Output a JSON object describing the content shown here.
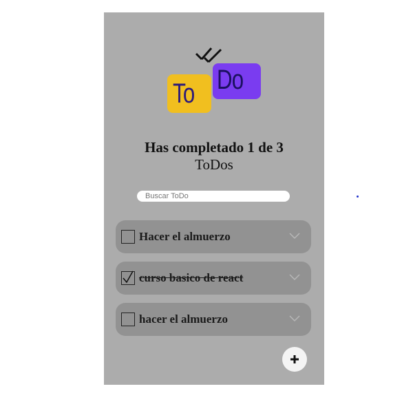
{
  "logo": {
    "to_text": "To",
    "do_text": "Do",
    "icon": "double-check-icon",
    "colors": {
      "to_bg": "#f1bf1f",
      "do_bg": "#7a3cf0"
    }
  },
  "counter": {
    "line1": "Has completado 1 de 3",
    "line2": "ToDos"
  },
  "search": {
    "placeholder": "Buscar ToDo",
    "value": ""
  },
  "todos": [
    {
      "text": "Hacer el almuerzo",
      "completed": false
    },
    {
      "text": "curso basico de react",
      "completed": true
    },
    {
      "text": "hacer el almuerzo",
      "completed": false
    }
  ],
  "add_button": {
    "icon": "plus-icon"
  },
  "colors": {
    "panel_bg": "#acacac",
    "item_bg": "#929292"
  }
}
